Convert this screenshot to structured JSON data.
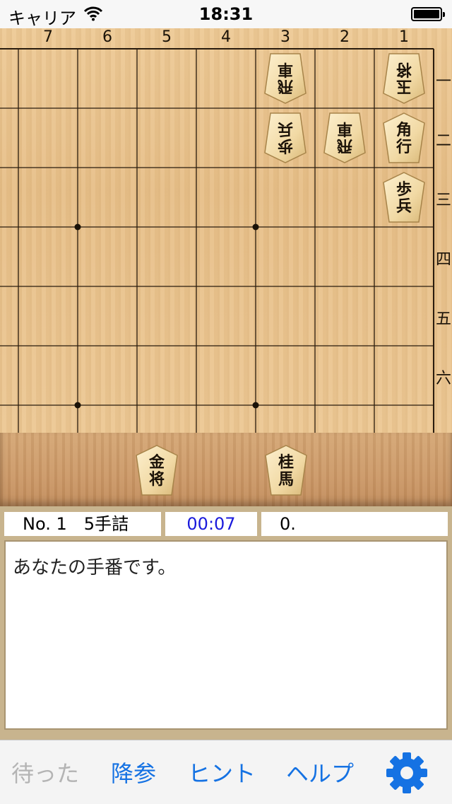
{
  "status": {
    "carrier": "キャリア",
    "time": "18:31"
  },
  "board": {
    "column_labels": [
      "7",
      "6",
      "5",
      "4",
      "3",
      "2",
      "1"
    ],
    "row_labels": [
      "一",
      "二",
      "三",
      "四",
      "五",
      "六"
    ],
    "pieces": [
      {
        "col": 3,
        "row": 1,
        "chars": [
          "飛",
          "車"
        ],
        "owner": "gote"
      },
      {
        "col": 1,
        "row": 1,
        "chars": [
          "玉",
          "将"
        ],
        "owner": "gote"
      },
      {
        "col": 3,
        "row": 2,
        "chars": [
          "歩",
          "兵"
        ],
        "owner": "gote"
      },
      {
        "col": 2,
        "row": 2,
        "chars": [
          "飛",
          "車"
        ],
        "owner": "gote"
      },
      {
        "col": 1,
        "row": 2,
        "chars": [
          "角",
          "行"
        ],
        "owner": "sente"
      },
      {
        "col": 1,
        "row": 3,
        "chars": [
          "歩",
          "兵"
        ],
        "owner": "sente"
      }
    ]
  },
  "hand": {
    "pieces": [
      {
        "chars": [
          "金",
          "将"
        ]
      },
      {
        "chars": [
          "桂",
          "馬"
        ]
      }
    ]
  },
  "info": {
    "problem": "No. 1　5手詰",
    "timer": "00:07",
    "score": "0."
  },
  "message": "あなたの手番です。",
  "toolbar": {
    "undo_label": "待った",
    "resign_label": "降参",
    "hint_label": "ヒント",
    "help_label": "ヘルプ"
  },
  "colors": {
    "accent": "#1572e3",
    "timer": "#1a1adc",
    "disabled": "#b4b4b4"
  }
}
